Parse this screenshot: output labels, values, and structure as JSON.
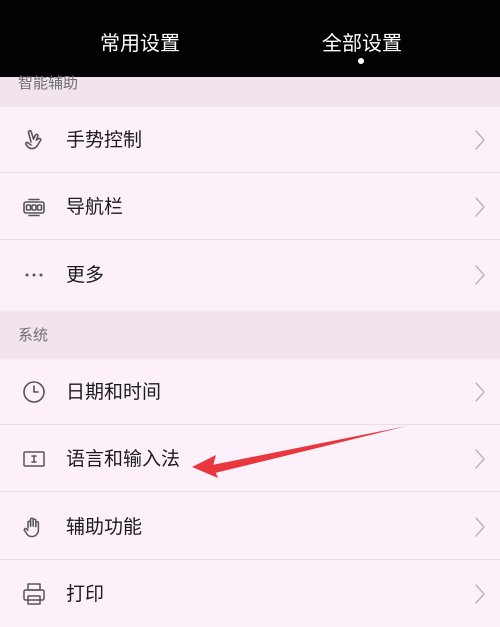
{
  "tabs": {
    "common": "常用设置",
    "all": "全部设置"
  },
  "sections": {
    "smart": {
      "title": "智能辅助",
      "items": [
        {
          "label": "手势控制",
          "icon": "gesture-hand-icon"
        },
        {
          "label": "导航栏",
          "icon": "navigation-bar-icon"
        },
        {
          "label": "更多",
          "icon": "more-dots-icon"
        }
      ]
    },
    "system": {
      "title": "系统",
      "items": [
        {
          "label": "日期和时间",
          "icon": "clock-icon"
        },
        {
          "label": "语言和输入法",
          "icon": "keyboard-input-icon"
        },
        {
          "label": "辅助功能",
          "icon": "accessibility-hand-icon"
        },
        {
          "label": "打印",
          "icon": "printer-icon"
        }
      ]
    }
  },
  "colors": {
    "topbar_bg": "#020202",
    "page_bg": "#fcf0fa",
    "section_bg": "#f2e4ef",
    "annotation_arrow": "#e8383d"
  }
}
